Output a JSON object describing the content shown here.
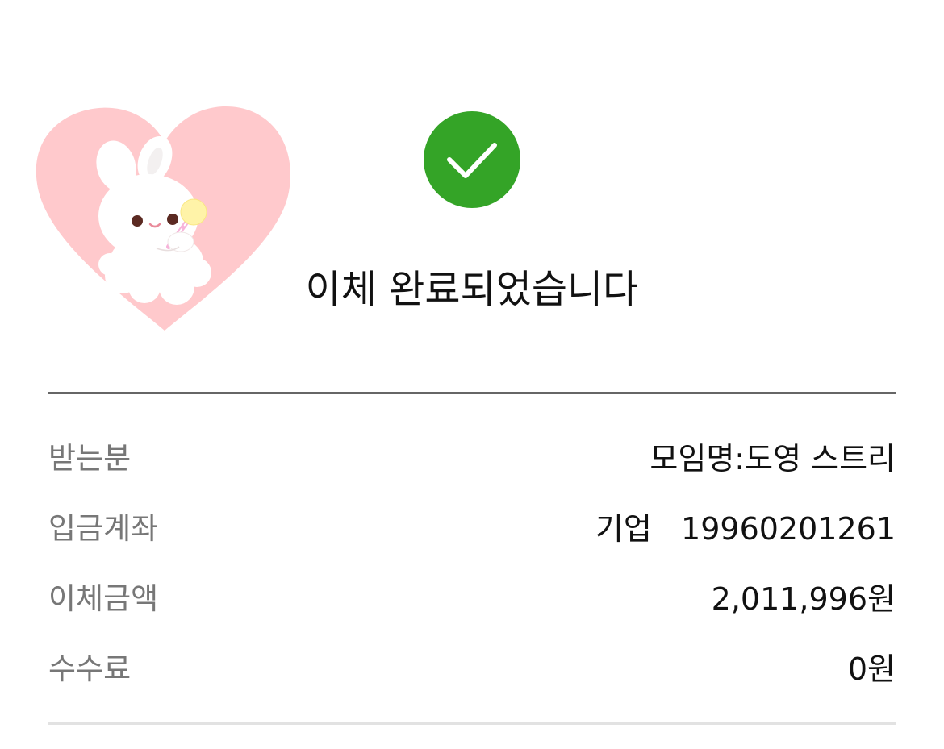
{
  "status": {
    "title": "이체 완료되었습니다",
    "icon": "check-circle-icon",
    "accent_color": "#34a427"
  },
  "sticker": {
    "description_icon": "bunny-heart-sticker",
    "heart_color": "#ffc9cc"
  },
  "details": [
    {
      "label": "받는분",
      "value": "모임명:도영 스트리"
    },
    {
      "label": "입금계좌",
      "value": "기업   19960201261"
    },
    {
      "label": "이체금액",
      "value": "2,011,996원"
    },
    {
      "label": "수수료",
      "value": "0원"
    }
  ]
}
